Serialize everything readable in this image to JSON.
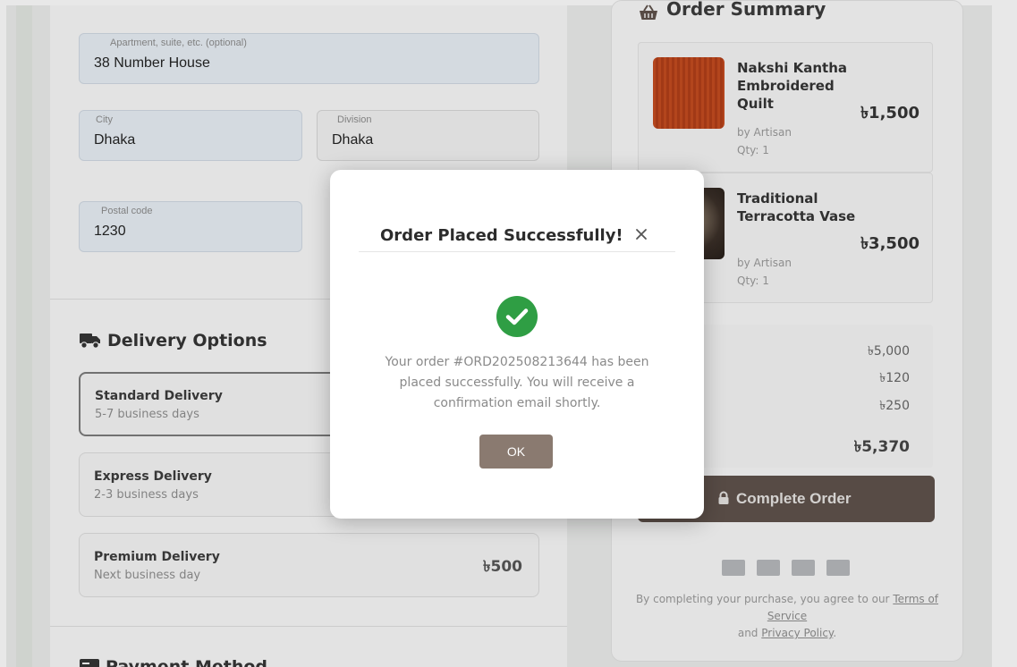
{
  "address": {
    "apartment_label": "Apartment, suite, etc. (optional)",
    "apartment_value": "38 Number House",
    "city_label": "City",
    "city_value": "Dhaka",
    "division_label": "Division",
    "division_value": "Dhaka",
    "postal_label": "Postal code",
    "postal_value": "1230"
  },
  "delivery": {
    "title": "Delivery Options",
    "options": [
      {
        "name": "Standard Delivery",
        "time": "5-7 business days",
        "price": "",
        "selected": true
      },
      {
        "name": "Express Delivery",
        "time": "2-3 business days",
        "price": ""
      },
      {
        "name": "Premium Delivery",
        "time": "Next business day",
        "price": "৳500"
      }
    ]
  },
  "payment": {
    "title": "Payment Method"
  },
  "summary": {
    "title": "Order Summary",
    "items": [
      {
        "name": "Nakshi Kantha Embroidered Quilt",
        "price": "৳1,500",
        "seller": "by Artisan",
        "qty": "Qty: 1"
      },
      {
        "name": "Traditional Terracotta Vase",
        "price": "৳3,500",
        "seller": "by Artisan",
        "qty": "Qty: 1"
      }
    ],
    "subtotal": "৳5,000",
    "shipping": "৳120",
    "tax": "৳250",
    "total": "৳5,370",
    "complete_label": "Complete Order",
    "legal_prefix": "By completing your purchase, you agree to our",
    "terms_link": "Terms of Service",
    "legal_and": "and",
    "privacy_link": "Privacy Policy",
    "legal_suffix": "."
  },
  "modal": {
    "title": "Order Placed Successfully!",
    "close": "×",
    "message": "Your order #ORD202508213644 has been placed successfully. You will receive a confirmation email shortly.",
    "ok_label": "OK"
  },
  "colors": {
    "success": "#2f9e44",
    "primary_button": "#5e514a",
    "ok_button": "#8a7a70"
  }
}
